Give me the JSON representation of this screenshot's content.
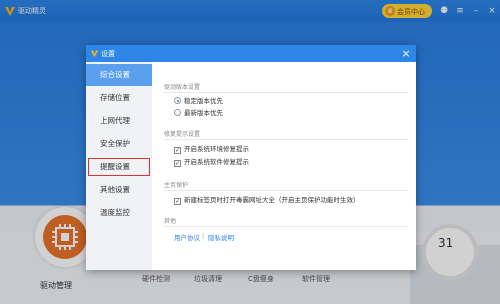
{
  "app": {
    "title": "驱动精灵",
    "vip_label": "会员中心",
    "vip_icon": "crown-icon",
    "toolbar_icons": [
      "game-icon",
      "menu-icon",
      "minimize-icon",
      "close-icon"
    ]
  },
  "bottom": {
    "manager_label": "驱动管理",
    "tools": [
      "硬件检测",
      "垃圾清理",
      "C盘瘦身",
      "软件管理"
    ],
    "score": "31",
    "green_button": "..."
  },
  "dialog": {
    "title": "设置",
    "close": "×",
    "nav": [
      {
        "label": "综合设置",
        "active": true
      },
      {
        "label": "存储位置",
        "active": false
      },
      {
        "label": "上网代理",
        "active": false
      },
      {
        "label": "安全保护",
        "active": false
      },
      {
        "label": "提醒设置",
        "active": false,
        "highlighted": true
      },
      {
        "label": "其他设置",
        "active": false
      },
      {
        "label": "温度监控",
        "active": false
      }
    ],
    "sections": {
      "driver_version": {
        "title": "驱动版本设置",
        "options": [
          {
            "label": "稳定版本优先",
            "selected": true
          },
          {
            "label": "最新版本优先",
            "selected": false
          }
        ]
      },
      "repair_tips": {
        "title": "修复提示设置",
        "options": [
          {
            "label": "开启系统环境修复提示",
            "checked": true
          },
          {
            "label": "开启系统软件修复提示",
            "checked": true
          }
        ]
      },
      "homepage": {
        "title": "主页保护",
        "options": [
          {
            "label": "新建标签页时打开毒霸网址大全（开启主页保护功能时生效）",
            "checked": true
          }
        ]
      },
      "other": {
        "title": "其他",
        "links": [
          "用户协议",
          "隐私说明"
        ],
        "separator": "|"
      }
    }
  }
}
